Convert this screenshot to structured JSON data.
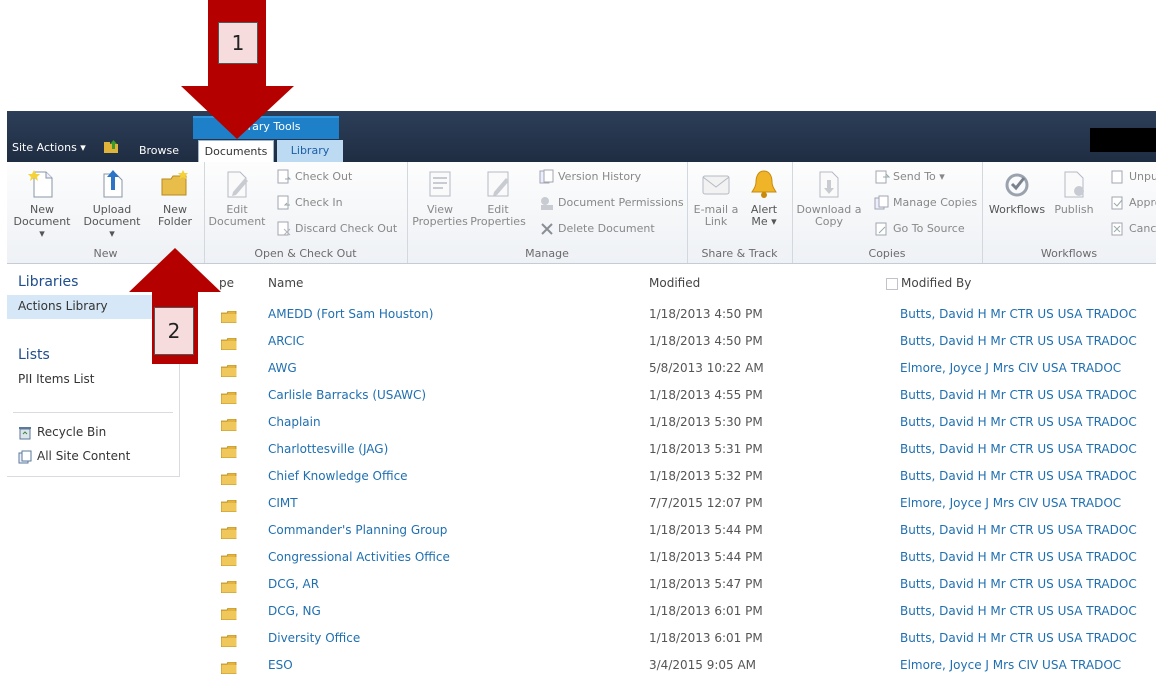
{
  "topbar": {
    "context_group": "Library Tools",
    "site_actions": "Site Actions ▾",
    "tabs": {
      "browse": "Browse",
      "documents": "Documents",
      "library": "Library"
    }
  },
  "ribbon": {
    "new": {
      "label": "New",
      "new_document": [
        "New",
        "Document ▾"
      ],
      "upload_document": [
        "Upload",
        "Document ▾"
      ],
      "new_folder": [
        "New",
        "Folder"
      ]
    },
    "open_checkout": {
      "label": "Open & Check Out",
      "edit_document": [
        "Edit",
        "Document"
      ],
      "check_out": "Check Out",
      "check_in": "Check In",
      "discard_check_out": "Discard Check Out"
    },
    "manage": {
      "label": "Manage",
      "view_properties": [
        "View",
        "Properties"
      ],
      "edit_properties": [
        "Edit",
        "Properties"
      ],
      "version_history": "Version History",
      "document_permissions": "Document Permissions",
      "delete_document": "Delete Document"
    },
    "share_track": {
      "label": "Share & Track",
      "email_link": [
        "E-mail a",
        "Link"
      ],
      "alert_me": [
        "Alert",
        "Me ▾"
      ]
    },
    "copies": {
      "label": "Copies",
      "download_copy": [
        "Download a",
        "Copy"
      ],
      "send_to": "Send To ▾",
      "manage_copies": "Manage Copies",
      "go_to_source": "Go To Source"
    },
    "workflows": {
      "label": "Workflows",
      "workflows": "Workflows",
      "publish": "Publish",
      "unpublish": "Unpu",
      "approve": "Appro",
      "cancel": "Cance"
    }
  },
  "leftnav": {
    "libraries_heading": "Libraries",
    "actions_library": "Actions Library",
    "lists_heading": "Lists",
    "pii_items": "PII Items List",
    "recycle_bin": "Recycle Bin",
    "all_site_content": "All Site Content"
  },
  "list": {
    "columns": {
      "type": "pe",
      "name": "Name",
      "modified": "Modified",
      "modified_by": "Modified By"
    },
    "rows": [
      {
        "name": "AMEDD (Fort Sam Houston)",
        "modified": "1/18/2013 4:50 PM",
        "by": "Butts, David H Mr CTR US USA TRADOC"
      },
      {
        "name": "ARCIC",
        "modified": "1/18/2013 4:50 PM",
        "by": "Butts, David H Mr CTR US USA TRADOC"
      },
      {
        "name": "AWG",
        "modified": "5/8/2013 10:22 AM",
        "by": "Elmore, Joyce J Mrs CIV USA TRADOC"
      },
      {
        "name": "Carlisle Barracks (USAWC)",
        "modified": "1/18/2013 4:55 PM",
        "by": "Butts, David H Mr CTR US USA TRADOC"
      },
      {
        "name": "Chaplain",
        "modified": "1/18/2013 5:30 PM",
        "by": "Butts, David H Mr CTR US USA TRADOC"
      },
      {
        "name": "Charlottesville (JAG)",
        "modified": "1/18/2013 5:31 PM",
        "by": "Butts, David H Mr CTR US USA TRADOC"
      },
      {
        "name": "Chief Knowledge Office",
        "modified": "1/18/2013 5:32 PM",
        "by": "Butts, David H Mr CTR US USA TRADOC"
      },
      {
        "name": "CIMT",
        "modified": "7/7/2015 12:07 PM",
        "by": "Elmore, Joyce J Mrs CIV USA TRADOC"
      },
      {
        "name": "Commander's Planning Group",
        "modified": "1/18/2013 5:44 PM",
        "by": "Butts, David H Mr CTR US USA TRADOC"
      },
      {
        "name": "Congressional Activities Office",
        "modified": "1/18/2013 5:44 PM",
        "by": "Butts, David H Mr CTR US USA TRADOC"
      },
      {
        "name": "DCG, AR",
        "modified": "1/18/2013 5:47 PM",
        "by": "Butts, David H Mr CTR US USA TRADOC"
      },
      {
        "name": "DCG, NG",
        "modified": "1/18/2013 6:01 PM",
        "by": "Butts, David H Mr CTR US USA TRADOC"
      },
      {
        "name": "Diversity Office",
        "modified": "1/18/2013 6:01 PM",
        "by": "Butts, David H Mr CTR US USA TRADOC"
      },
      {
        "name": "ESO",
        "modified": "3/4/2015 9:05 AM",
        "by": "Elmore, Joyce J Mrs CIV USA TRADOC"
      }
    ]
  },
  "callouts": {
    "one": "1",
    "two": "2"
  },
  "colors": {
    "arrow": "#b50000",
    "link": "#1f6fb0",
    "topbar": "#22324a",
    "context_tab": "#1e80c9"
  }
}
